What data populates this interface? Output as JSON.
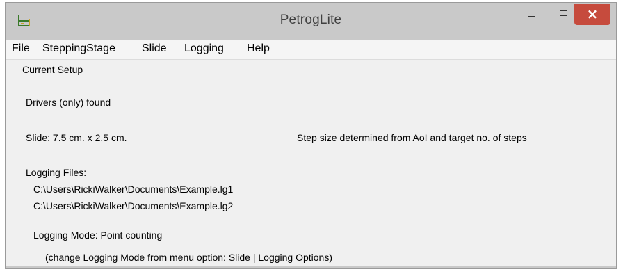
{
  "window": {
    "title": "PetrogLite",
    "icon": "app-icon",
    "close_glyph": "×"
  },
  "menu": {
    "items": [
      "File",
      "SteppingStage",
      "Slide",
      "Logging",
      "Help"
    ]
  },
  "setup": {
    "group_label": "Current Setup",
    "drivers_status": "Drivers (only) found",
    "slide_size": "Slide: 7.5 cm. x 2.5 cm.",
    "step_size_note": "Step size determined from AoI and target no. of steps",
    "logging_files_label": "Logging Files:",
    "logging_file_1": "C:\\Users\\RickiWalker\\Documents\\Example.lg1",
    "logging_file_2": "C:\\Users\\RickiWalker\\Documents\\Example.lg2",
    "logging_mode": "Logging Mode: Point counting",
    "logging_mode_hint": "(change Logging Mode from menu option: Slide | Logging Options)"
  }
}
